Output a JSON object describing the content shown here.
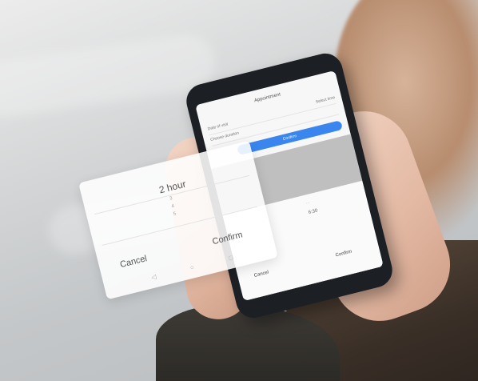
{
  "phone_screen": {
    "title": "Appointment",
    "row1_label": "Date of visit",
    "row1_value": "Select time",
    "row2_label": "Choose duration",
    "confirm": "Confirm",
    "sheet_value": "6:30",
    "cancel": "Cancel",
    "confirm_bottom": "Confirm"
  },
  "picker_card": {
    "value": "2 hour",
    "options": [
      "3",
      "4",
      "5"
    ],
    "cancel": "Cancel",
    "confirm": "Confirm",
    "nav": [
      "◁",
      "○",
      "□"
    ]
  }
}
